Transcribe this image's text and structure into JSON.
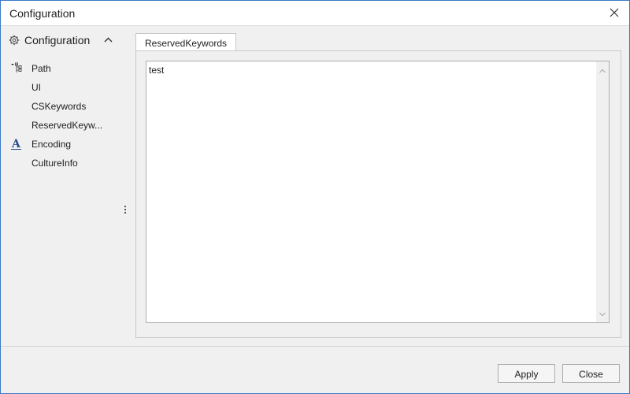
{
  "window": {
    "title": "Configuration"
  },
  "nav": {
    "header": "Configuration",
    "items": [
      {
        "label": "Path",
        "icon": "tree-path-icon"
      },
      {
        "label": "UI",
        "icon": ""
      },
      {
        "label": "CSKeywords",
        "icon": ""
      },
      {
        "label": "ReservedKeyw...",
        "icon": ""
      },
      {
        "label": "Encoding",
        "icon": "font-a-icon"
      },
      {
        "label": "CultureInfo",
        "icon": ""
      }
    ]
  },
  "tab": {
    "label": "ReservedKeywords"
  },
  "editor": {
    "value": "test"
  },
  "buttons": {
    "apply": "Apply",
    "close": "Close"
  },
  "colors": {
    "window_border": "#3c78c8",
    "accent_icon": "#2a4d8f"
  }
}
